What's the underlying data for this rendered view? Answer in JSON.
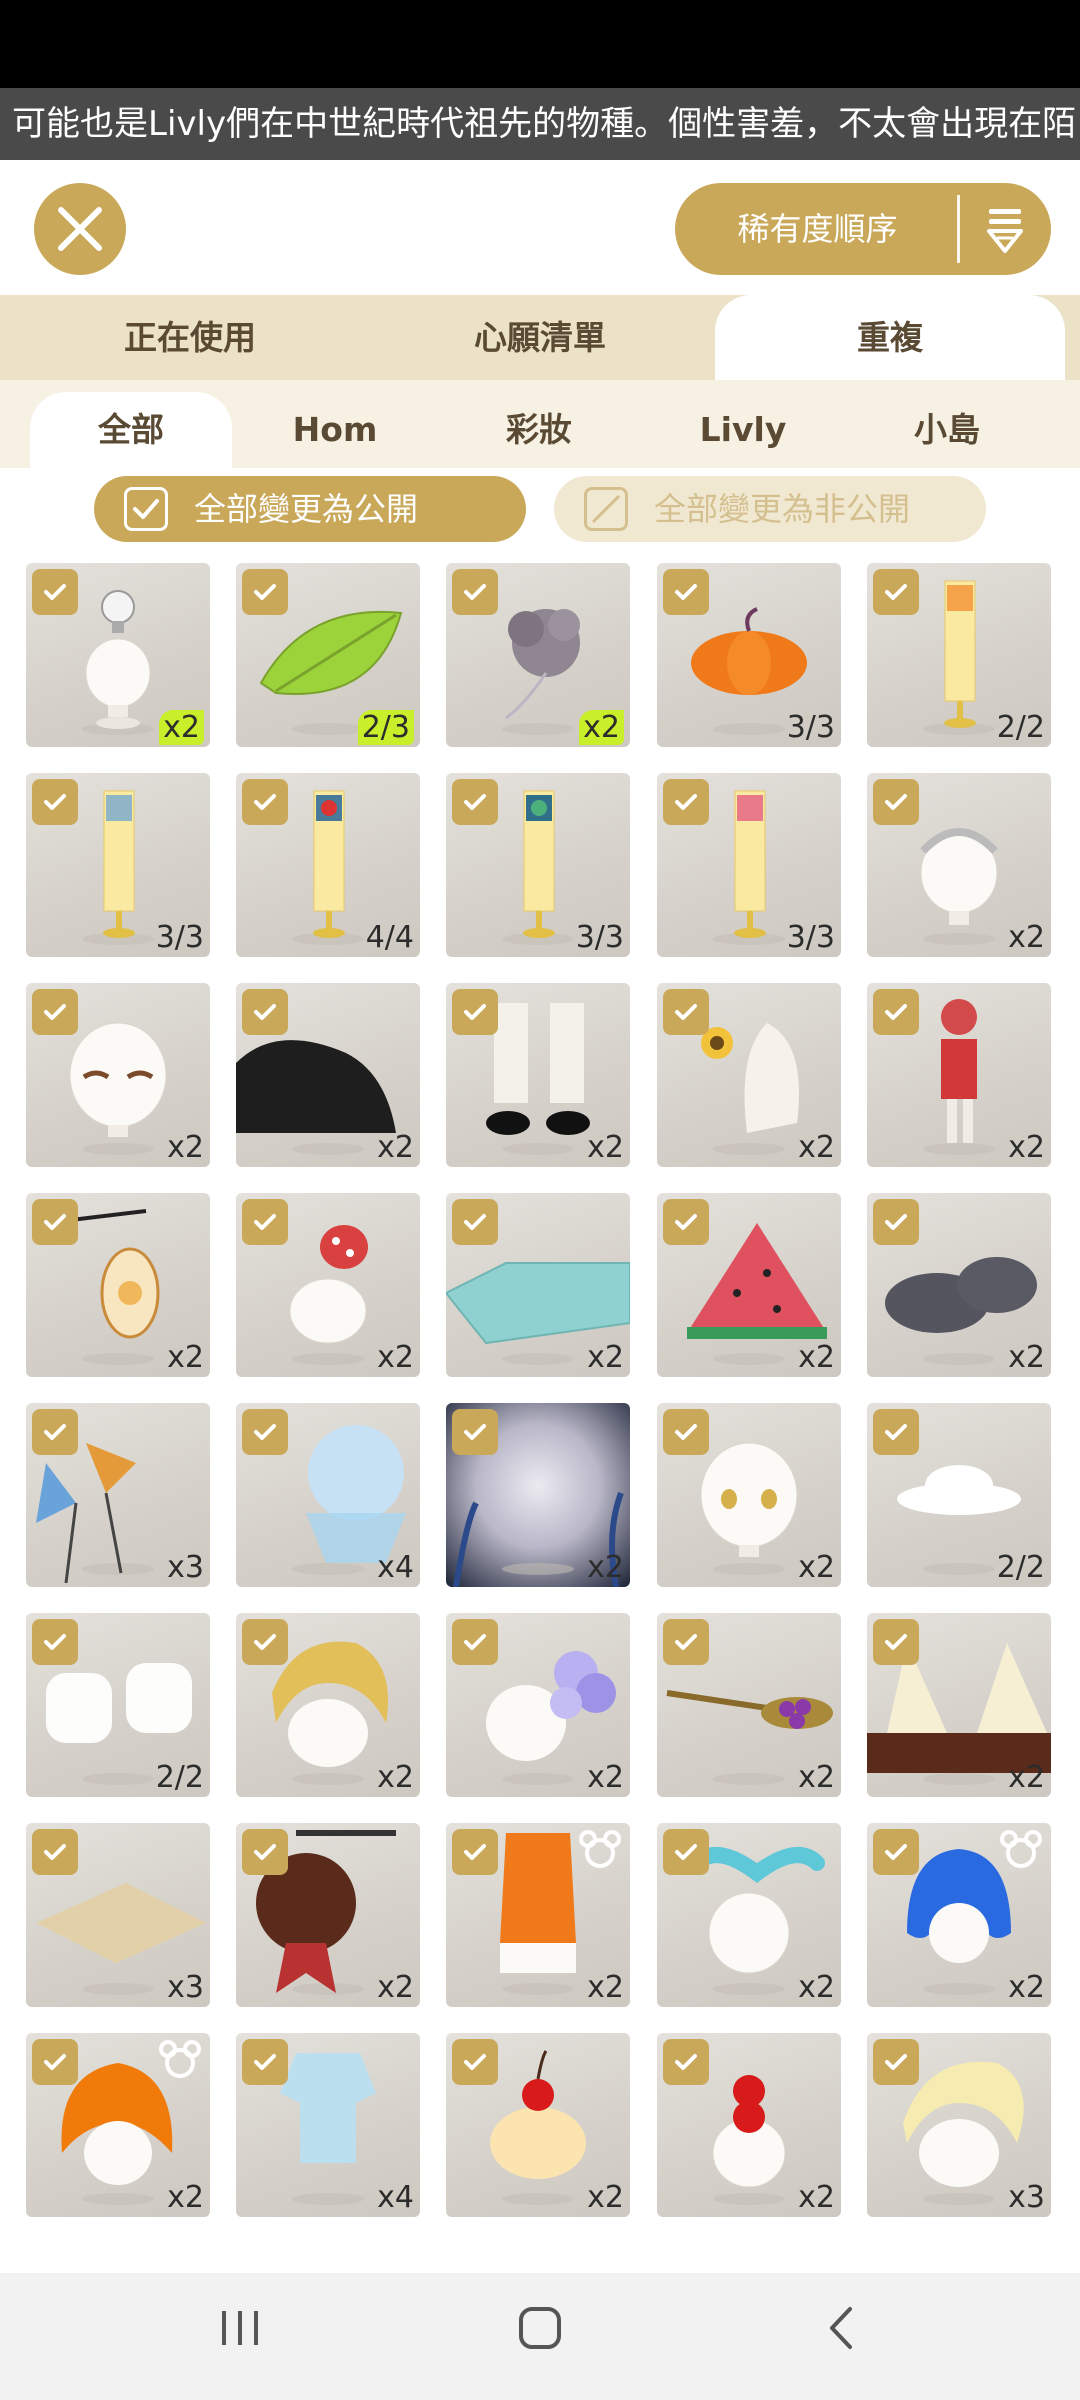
{
  "ticker": {
    "text": "可能也是Livly們在中世紀時代祖先的物種。個性害羞，不太會出現在陌"
  },
  "header": {
    "sort_label": "稀有度順序"
  },
  "tabs_primary": [
    {
      "label": "正在使用",
      "active": false
    },
    {
      "label": "心願清單",
      "active": false
    },
    {
      "label": "重複",
      "active": true
    }
  ],
  "tabs_secondary": [
    {
      "label": "全部",
      "active": true
    },
    {
      "label": "Hom",
      "active": false
    },
    {
      "label": "彩妝",
      "active": false
    },
    {
      "label": "Livly",
      "active": false
    },
    {
      "label": "小島",
      "active": false
    }
  ],
  "visibility": {
    "make_public": "全部變更為公開",
    "make_private": "全部變更為非公開"
  },
  "colors": {
    "accent": "#c9a85a",
    "tab_bg": "#ece2c8",
    "highlight": "#c8ef2a"
  },
  "items": [
    {
      "name": "lightbulb-head-item",
      "count": "x2",
      "hl": true
    },
    {
      "name": "leaf-item",
      "count": "2/3",
      "hl": true
    },
    {
      "name": "purple-flower-item",
      "count": "x2",
      "hl": true
    },
    {
      "name": "pumpkin-item",
      "count": "3/3"
    },
    {
      "name": "anniversary-banner-tiger-item",
      "count": "2/2"
    },
    {
      "name": "anniversary-banner-white-item",
      "count": "3/3"
    },
    {
      "name": "anniversary-banner-red-item",
      "count": "4/4"
    },
    {
      "name": "anniversary-banner-green-item",
      "count": "3/3"
    },
    {
      "name": "anniversary-banner-pink-item",
      "count": "3/3"
    },
    {
      "name": "tiara-head-item",
      "count": "x2"
    },
    {
      "name": "eye-makeup-item",
      "count": "x2"
    },
    {
      "name": "black-fur-boots-item",
      "count": "x2"
    },
    {
      "name": "white-socks-shoes-item",
      "count": "x2"
    },
    {
      "name": "sunflower-vase-item",
      "count": "x2"
    },
    {
      "name": "red-outfit-item",
      "count": "x2"
    },
    {
      "name": "lantern-item",
      "count": "x2"
    },
    {
      "name": "mushroom-hat-item",
      "count": "x2"
    },
    {
      "name": "blue-quilt-item",
      "count": "x2"
    },
    {
      "name": "watermelon-item",
      "count": "x2"
    },
    {
      "name": "grey-stones-item",
      "count": "x2"
    },
    {
      "name": "pinwheel-item",
      "count": "x3"
    },
    {
      "name": "shaved-ice-item",
      "count": "x4"
    },
    {
      "name": "dark-background-item",
      "count": "x2"
    },
    {
      "name": "yellow-eyes-item",
      "count": "x2"
    },
    {
      "name": "white-hat-item",
      "count": "2/2"
    },
    {
      "name": "marshmallow-item",
      "count": "2/2"
    },
    {
      "name": "blonde-hair-item",
      "count": "x2"
    },
    {
      "name": "hydrangea-hair-item",
      "count": "x2"
    },
    {
      "name": "grape-spoon-item",
      "count": "x2"
    },
    {
      "name": "sandwich-item",
      "count": "x2"
    },
    {
      "name": "straw-mat-item",
      "count": "x3"
    },
    {
      "name": "bakery-sign-item",
      "count": "x2"
    },
    {
      "name": "orange-vest-item",
      "count": "x2",
      "bear": true
    },
    {
      "name": "bunny-ears-item",
      "count": "x2"
    },
    {
      "name": "blue-hair-item",
      "count": "x2",
      "bear": true
    },
    {
      "name": "orange-hair-item",
      "count": "x2",
      "bear": true
    },
    {
      "name": "blue-shirt-item",
      "count": "x4"
    },
    {
      "name": "cherry-pudding-item",
      "count": "x2"
    },
    {
      "name": "cherry-head-item",
      "count": "x2"
    },
    {
      "name": "pale-blonde-hair-item",
      "count": "x3"
    }
  ]
}
